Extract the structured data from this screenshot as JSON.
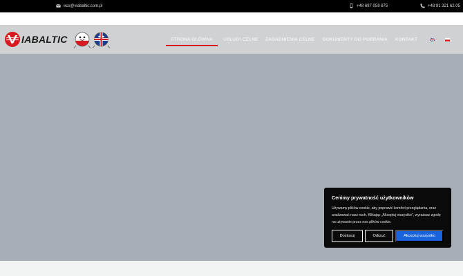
{
  "topbar": {
    "email": "ecs@viabaltic.com.pl",
    "mobile": "+48 697 059 675",
    "landline": "+48 91 321 62 05",
    "email_icon": "envelope-icon",
    "mobile_icon": "mobile-phone-icon",
    "landline_icon": "phone-icon"
  },
  "header": {
    "logo_text": "IABALTIC",
    "nav": [
      {
        "label": "STRONA GŁÓWNA",
        "active": true
      },
      {
        "label": "USŁUGI CELNE"
      },
      {
        "label": "ZAGADNIENIA CELNE"
      },
      {
        "label": "DOKUMENTY DO POBRANIA"
      },
      {
        "label": "KONTAKT"
      }
    ],
    "languages": [
      "en-flag-icon",
      "pl-flag-icon"
    ]
  },
  "cookie": {
    "title": "Cenimy prywatność użytkowników",
    "text": "Używamy plików cookie, aby poprawić komfort przeglądania, oraz analizować nasz ruch. Klikając „Akceptuj wszystko”, wyrażasz zgodę na używanie przez nas plików cookie.",
    "customize_label": "Dostosuj",
    "reject_label": "Odrzuć",
    "accept_label": "Akceptuj wszystko"
  },
  "colors": {
    "accent_red": "#d71920",
    "accept_blue": "#1863dc",
    "hero_gray": "#a7aeb5"
  }
}
